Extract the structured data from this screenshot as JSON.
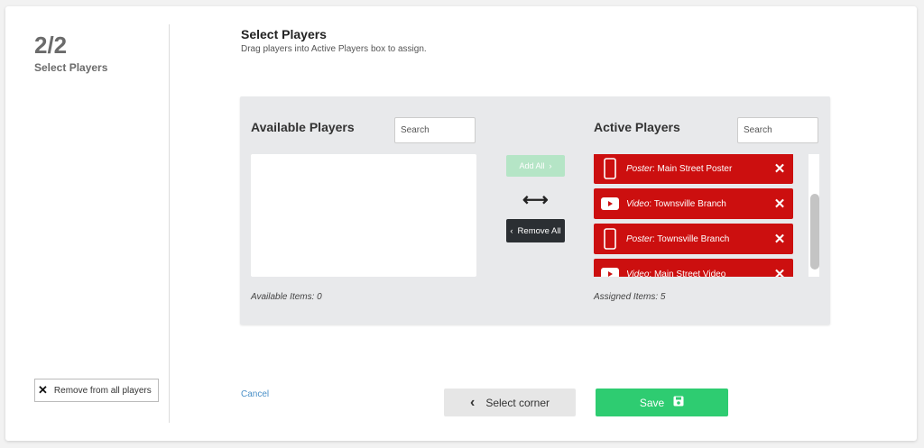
{
  "step": {
    "number": "2/2",
    "title": "Select Players"
  },
  "sidebar": {
    "remove_all_label": "Remove from all players"
  },
  "header": {
    "title": "Select Players",
    "subtitle": "Drag players into Active Players box to assign."
  },
  "available": {
    "title": "Available Players",
    "search_placeholder": "Search",
    "count_label": "Available Items: 0"
  },
  "controls": {
    "add_all_label": "Add All",
    "add_all_enabled": false,
    "remove_all_label": "Remove All"
  },
  "active": {
    "title": "Active Players",
    "search_placeholder": "Search",
    "count_label": "Assigned Items: 5",
    "items": [
      {
        "type": "Poster",
        "name": "Main Street Poster",
        "icon": "poster-icon"
      },
      {
        "type": "Video",
        "name": "Townsville Branch",
        "icon": "video-icon"
      },
      {
        "type": "Poster",
        "name": "Townsville Branch",
        "icon": "poster-icon"
      },
      {
        "type": "Video",
        "name": "Main Street Video",
        "icon": "video-icon"
      }
    ]
  },
  "footer": {
    "cancel_label": "Cancel",
    "back_label": "Select corner",
    "save_label": "Save"
  },
  "colors": {
    "item_bg": "#cc0f0f",
    "save_bg": "#2ecc71",
    "add_all_bg": "#b5e5c6",
    "remove_all_bg": "#2b2f33",
    "link": "#4a90c8"
  }
}
